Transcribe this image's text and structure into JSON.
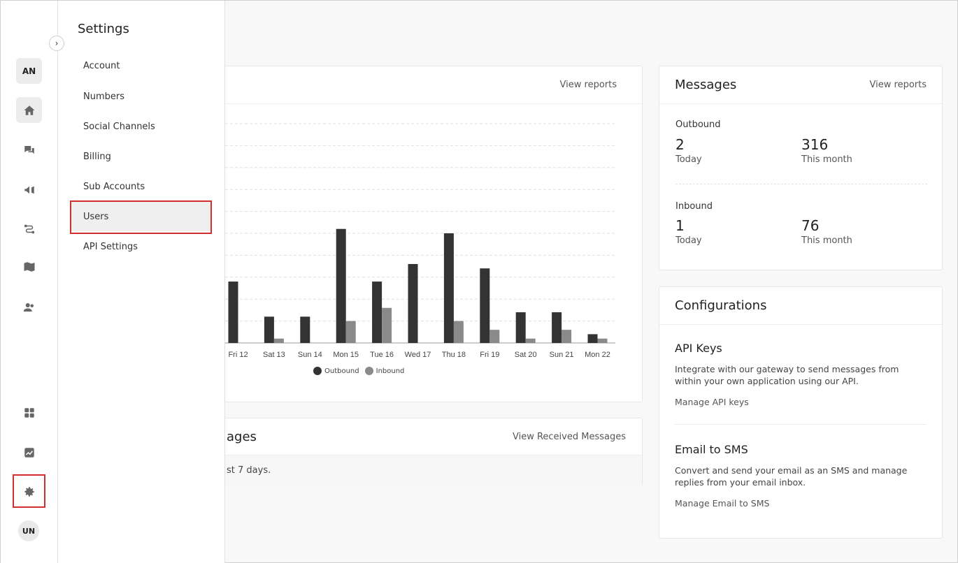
{
  "rail": {
    "top_avatar": "AN",
    "bottom_avatar": "UN",
    "icons": [
      "home-icon",
      "chat-icon",
      "megaphone-icon",
      "flow-icon",
      "book-icon",
      "contacts-icon",
      "apps-icon",
      "analytics-icon",
      "gear-icon"
    ]
  },
  "settings_panel": {
    "title": "Settings",
    "items": [
      {
        "label": "Account"
      },
      {
        "label": "Numbers"
      },
      {
        "label": "Social Channels"
      },
      {
        "label": "Billing"
      },
      {
        "label": "Sub Accounts"
      },
      {
        "label": "Users",
        "active": true
      },
      {
        "label": "API Settings"
      }
    ]
  },
  "activity_card": {
    "link": "View reports",
    "legend": [
      "Outbound",
      "Inbound"
    ]
  },
  "chart_data": {
    "type": "bar",
    "categories": [
      "Fri 12",
      "Sat 13",
      "Sun 14",
      "Mon 15",
      "Tue 16",
      "Wed 17",
      "Thu 18",
      "Fri 19",
      "Sat 20",
      "Sun 21",
      "Mon 22"
    ],
    "series": [
      {
        "name": "Outbound",
        "values": [
          28,
          12,
          12,
          52,
          28,
          36,
          50,
          34,
          14,
          14,
          4
        ]
      },
      {
        "name": "Inbound",
        "values": [
          0,
          2,
          0,
          10,
          16,
          0,
          10,
          6,
          2,
          6,
          2
        ]
      }
    ],
    "ylim": [
      0,
      100
    ],
    "grid": true,
    "legend_position": "bottom",
    "colors": {
      "Outbound": "#333333",
      "Inbound": "#8a8a8a"
    }
  },
  "received_card": {
    "title_fragment": "ages",
    "link": "View Received Messages",
    "note_fragment": "st 7 days."
  },
  "messages_card": {
    "title": "Messages",
    "link": "View reports",
    "outbound_label": "Outbound",
    "outbound_today": "2",
    "outbound_month": "316",
    "inbound_label": "Inbound",
    "inbound_today": "1",
    "inbound_month": "76",
    "today_label": "Today",
    "month_label": "This month"
  },
  "config_card": {
    "title": "Configurations",
    "api_title": "API Keys",
    "api_desc": "Integrate with our gateway to send messages from within your own application using our API.",
    "api_link": "Manage API keys",
    "email_title": "Email to SMS",
    "email_desc": "Convert and send your email as an SMS and manage replies from your email inbox.",
    "email_link": "Manage Email to SMS"
  }
}
